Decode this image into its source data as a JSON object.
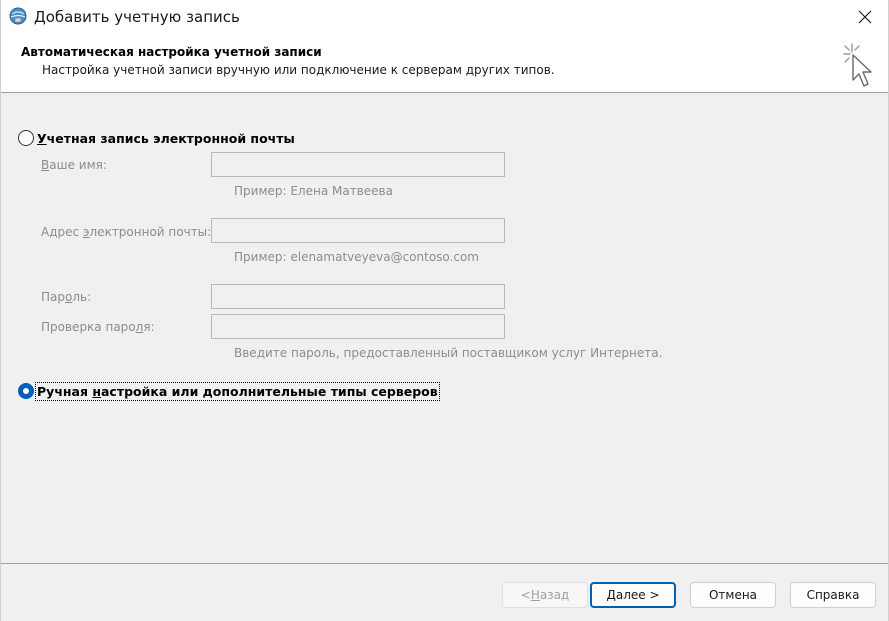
{
  "window": {
    "title": "Добавить учетную запись",
    "icon": "outlook-account-icon",
    "close_icon": "close-icon"
  },
  "header": {
    "title": "Автоматическая настройка учетной записи",
    "subtitle": "Настройка учетной записи вручную или подключение к серверам других типов.",
    "icon": "wizard-cursor-icon"
  },
  "options": {
    "email_account": {
      "label_pre": "У",
      "label_rest": "четная запись электронной почты",
      "checked": false
    },
    "manual": {
      "label_pre": "Р",
      "label_rest": "учная ",
      "label_u2": "н",
      "label_tail": "астройка или дополнительные типы серверов",
      "checked": true
    }
  },
  "form": {
    "name": {
      "label_pre": "",
      "label_u": "В",
      "label_rest": "аше имя:",
      "value": "",
      "hint": "Пример: Елена Матвеева"
    },
    "email": {
      "label_pre": "Адрес ",
      "label_u": "э",
      "label_rest": "лектронной почты:",
      "value": "",
      "hint": "Пример: elenamatveyeva@contoso.com"
    },
    "password": {
      "label_pre": "Пар",
      "label_u": "о",
      "label_rest": "ль:",
      "value": ""
    },
    "password_confirm": {
      "label_pre": "Проверка паро",
      "label_u": "л",
      "label_rest": "я:",
      "value": "",
      "hint": "Введите пароль, предоставленный поставщиком услуг Интернета."
    }
  },
  "buttons": {
    "back": {
      "pre": "< ",
      "u": "Н",
      "rest": "азад",
      "enabled": false
    },
    "next": {
      "pre": "",
      "u": "Д",
      "rest": "алее >",
      "enabled": true
    },
    "cancel": {
      "label": "Отмена"
    },
    "help": {
      "label": "Справка"
    }
  },
  "colors": {
    "accent": "#005fb8",
    "disabled_text": "#8c8c8c",
    "background": "#f0f0f0",
    "header_bg": "#ffffff"
  }
}
